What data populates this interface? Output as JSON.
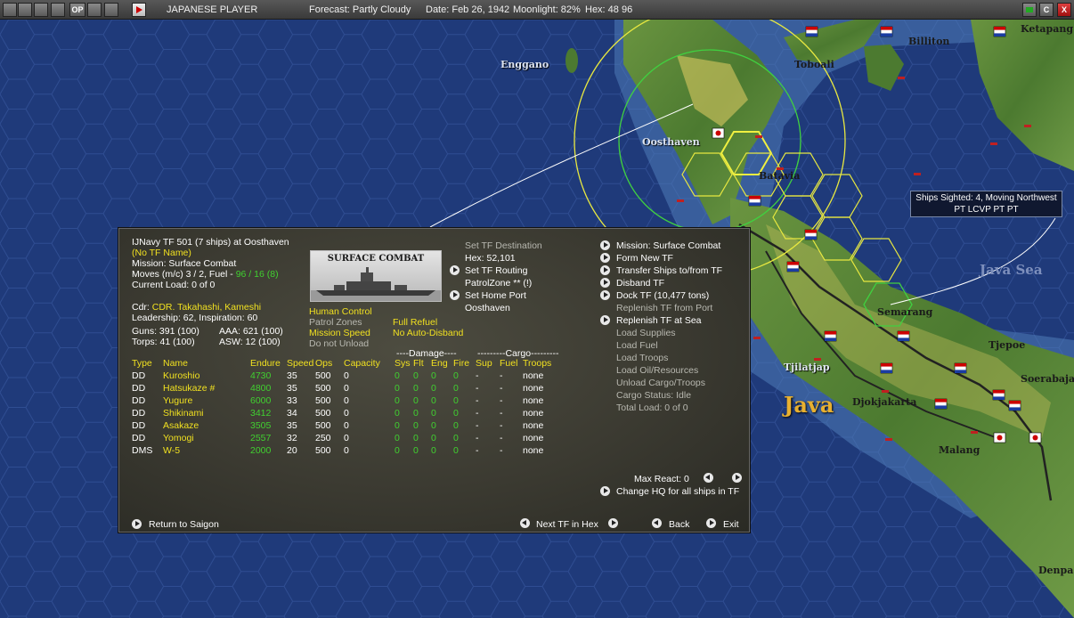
{
  "topbar": {
    "player": "JAPANESE PLAYER",
    "forecast": "Forecast: Partly Cloudy",
    "date": "Date: Feb 26, 1942",
    "moonlight": "Moonlight: 82%",
    "hex": "Hex: 48 96",
    "left_buttons": [
      "",
      "",
      "",
      "",
      "OP",
      "",
      ""
    ],
    "right_buttons": [
      "",
      "C",
      "X"
    ]
  },
  "map": {
    "places": {
      "enggano": "Enggano",
      "toboali": "Toboali",
      "billiton": "Billiton",
      "ketapang": "Ketapang",
      "oosthaven": "Oosthaven",
      "batavia": "Batavia",
      "semarang": "Semarang",
      "tjepoe": "Tjepoe",
      "soerabaja": "Soerabaja",
      "tjilatjap": "Tjilatjap",
      "djokjakarta": "Djokjakarta",
      "malang": "Malang",
      "denpa": "Denpa"
    },
    "java": "Java",
    "java_sea": "Java Sea",
    "sighting": {
      "line1": "Ships Sighted: 4, Moving Northwest",
      "line2": "PT LCVP PT PT"
    }
  },
  "tf": {
    "header": "IJNavy TF 501 (7 ships) at Oosthaven",
    "name_note": "(No TF Name)",
    "mission": "Mission: Surface Combat",
    "moves_prefix": "Moves (m/c)  3 / 2, Fuel - ",
    "fuel": "96 / 16 (8)",
    "current_load": "Current Load:  0 of 0",
    "cdr_label": "Cdr:",
    "cdr": "CDR. Takahashi, Kameshi",
    "leadership": "Leadership: 62, Inspiration: 60",
    "guns": "Guns: 391 (100)",
    "aaa": "AAA: 621 (100)",
    "torps": "Torps: 41 (100)",
    "asw": "ASW: 12 (100)",
    "picture_title": "SURFACE COMBAT",
    "center": {
      "set_destination": "Set TF Destination",
      "hex": "Hex: 52,101",
      "set_routing": "Set TF Routing",
      "patrol_zone": "PatrolZone  ** (!)",
      "set_home_port": "Set Home Port",
      "home_port": "Oosthaven"
    },
    "options": {
      "human_control": "Human Control",
      "patrol_zones": "Patrol Zones",
      "mission_speed": "Mission Speed",
      "do_not_unload": "Do not Unload",
      "full_refuel": "Full Refuel",
      "no_auto_disband": "No Auto-Disband"
    },
    "right_menu": [
      "Mission: Surface Combat",
      "Form New TF",
      "Transfer Ships to/from TF",
      "Disband TF",
      "Dock TF (10,477 tons)",
      "Replenish TF from Port",
      "Replenish TF at Sea",
      "Load Supplies",
      "Load Fuel",
      "Load Troops",
      "Load Oil/Resources",
      "Unload Cargo/Troops",
      "Cargo Status: Idle",
      "Total Load: 0 of 0"
    ],
    "max_react": "Max React:  0",
    "change_hq": "Change HQ for all ships in TF",
    "return_to": "Return to Saigon",
    "next_tf": "Next TF in Hex",
    "back": "Back",
    "exit": "Exit",
    "group_damage": "----Damage----",
    "group_cargo": "---------Cargo---------",
    "columns": [
      "Type",
      "Name",
      "Endure",
      "Speed",
      "Ops",
      "Capacity",
      "Sys",
      "Flt",
      "Eng",
      "Fire",
      "Sup",
      "Fuel",
      "Troops"
    ],
    "ships": [
      {
        "type": "DD",
        "name": "Kuroshio",
        "endure": "4730",
        "speed": "35",
        "ops": "500",
        "capacity": "0",
        "sys": "0",
        "flt": "0",
        "eng": "0",
        "fire": "0",
        "sup": "-",
        "fuel": "-",
        "troops": "none"
      },
      {
        "type": "DD",
        "name": "Hatsukaze #",
        "endure": "4800",
        "speed": "35",
        "ops": "500",
        "capacity": "0",
        "sys": "0",
        "flt": "0",
        "eng": "0",
        "fire": "0",
        "sup": "-",
        "fuel": "-",
        "troops": "none"
      },
      {
        "type": "DD",
        "name": "Yugure",
        "endure": "6000",
        "speed": "33",
        "ops": "500",
        "capacity": "0",
        "sys": "0",
        "flt": "0",
        "eng": "0",
        "fire": "0",
        "sup": "-",
        "fuel": "-",
        "troops": "none"
      },
      {
        "type": "DD",
        "name": "Shikinami",
        "endure": "3412",
        "speed": "34",
        "ops": "500",
        "capacity": "0",
        "sys": "0",
        "flt": "0",
        "eng": "0",
        "fire": "0",
        "sup": "-",
        "fuel": "-",
        "troops": "none"
      },
      {
        "type": "DD",
        "name": "Asakaze",
        "endure": "3505",
        "speed": "35",
        "ops": "500",
        "capacity": "0",
        "sys": "0",
        "flt": "0",
        "eng": "0",
        "fire": "0",
        "sup": "-",
        "fuel": "-",
        "troops": "none"
      },
      {
        "type": "DD",
        "name": "Yomogi",
        "endure": "2557",
        "speed": "32",
        "ops": "250",
        "capacity": "0",
        "sys": "0",
        "flt": "0",
        "eng": "0",
        "fire": "0",
        "sup": "-",
        "fuel": "-",
        "troops": "none"
      },
      {
        "type": "DMS",
        "name": "W-5",
        "endure": "2000",
        "speed": "20",
        "ops": "500",
        "capacity": "0",
        "sys": "0",
        "flt": "0",
        "eng": "0",
        "fire": "0",
        "sup": "-",
        "fuel": "-",
        "troops": "none"
      }
    ]
  },
  "colors": {
    "ocean": "#1f3a7a",
    "land": "#5f8a3a",
    "panel": "#3b3a31",
    "highlight_yellow": "#f0e020",
    "value_green": "#40d030"
  }
}
